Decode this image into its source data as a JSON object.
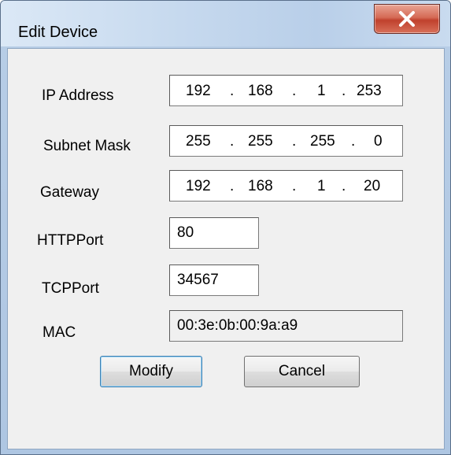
{
  "window": {
    "title": "Edit Device",
    "close_glyph": "X"
  },
  "form": {
    "ip_address": {
      "label": "IP Address",
      "octets": [
        "192",
        "168",
        "1",
        "253"
      ],
      "dot": "."
    },
    "subnet_mask": {
      "label": "Subnet Mask",
      "octets": [
        "255",
        "255",
        "255",
        "0"
      ],
      "dot": "."
    },
    "gateway": {
      "label": "Gateway",
      "octets": [
        "192",
        "168",
        "1",
        "20"
      ],
      "dot": "."
    },
    "http_port": {
      "label": "HTTPPort",
      "value": "80"
    },
    "tcp_port": {
      "label": "TCPPort",
      "value": "34567"
    },
    "mac": {
      "label": "MAC",
      "value": "00:3e:0b:00:9a:a9"
    }
  },
  "buttons": {
    "modify": "Modify",
    "cancel": "Cancel"
  }
}
